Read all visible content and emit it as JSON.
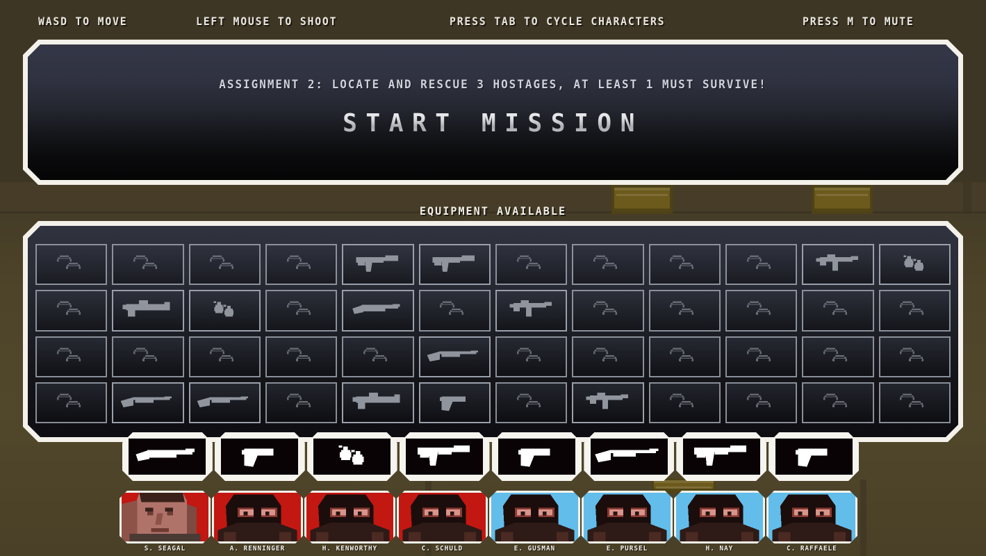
{
  "hints": [
    {
      "id": "move",
      "label": "WASD TO MOVE"
    },
    {
      "id": "shoot",
      "label": "LEFT MOUSE TO SHOOT"
    },
    {
      "id": "cycle",
      "label": "PRESS TAB TO CYCLE CHARACTERS"
    },
    {
      "id": "mute",
      "label": "PRESS M TO MUTE"
    }
  ],
  "mission": {
    "objective": "ASSIGNMENT 2:  LOCATE AND RESCUE 3 HOSTAGES,  AT LEAST 1 MUST SURVIVE!",
    "start_label": "START MISSION"
  },
  "equipment": {
    "heading": "EQUIPMENT AVAILABLE",
    "rows": 4,
    "columns": 12,
    "cells": [
      "ammo-clips",
      "ammo-clips",
      "ammo-clips",
      "ammo-clips",
      "assault-rifle",
      "assault-rifle",
      "ammo-clips",
      "ammo-clips",
      "ammo-clips",
      "ammo-clips",
      "submachine-gun",
      "grenades",
      "ammo-clips",
      "rocket-launcher",
      "grenades",
      "ammo-clips",
      "shotgun",
      "ammo-clips",
      "submachine-gun",
      "ammo-clips",
      "ammo-clips",
      "ammo-clips",
      "ammo-clips",
      "ammo-clips",
      "ammo-clips",
      "ammo-clips",
      "ammo-clips",
      "ammo-clips",
      "ammo-clips",
      "rifle",
      "ammo-clips",
      "ammo-clips",
      "ammo-clips",
      "ammo-clips",
      "ammo-clips",
      "ammo-clips",
      "ammo-clips",
      "rifle",
      "rifle",
      "ammo-clips",
      "rocket-launcher",
      "pistol",
      "ammo-clips",
      "submachine-gun",
      "ammo-clips",
      "ammo-clips",
      "ammo-clips",
      "ammo-clips"
    ]
  },
  "weapon_slots": [
    {
      "index": 1,
      "icon": "shotgun"
    },
    {
      "index": 2,
      "icon": "pistol"
    },
    {
      "index": 3,
      "icon": "grenades"
    },
    {
      "index": 4,
      "icon": "assault-rifle"
    },
    {
      "index": 5,
      "icon": "pistol"
    },
    {
      "index": 6,
      "icon": "rifle"
    },
    {
      "index": 7,
      "icon": "assault-rifle"
    },
    {
      "index": 8,
      "icon": "pistol"
    }
  ],
  "characters": [
    {
      "name": "S. SEAGAL",
      "team_color": "#c31712",
      "face": "unmasked"
    },
    {
      "name": "A. RENNINGER",
      "team_color": "#c31712",
      "face": "masked"
    },
    {
      "name": "H. KENWORTHY",
      "team_color": "#c31712",
      "face": "masked"
    },
    {
      "name": "C. SCHULD",
      "team_color": "#c31712",
      "face": "masked"
    },
    {
      "name": "E. GUSMAN",
      "team_color": "#62bdea",
      "face": "masked"
    },
    {
      "name": "E. PURSEL",
      "team_color": "#62bdea",
      "face": "masked"
    },
    {
      "name": "H. NAY",
      "team_color": "#62bdea",
      "face": "masked"
    },
    {
      "name": "C. RAFFAELE",
      "team_color": "#62bdea",
      "face": "masked"
    }
  ],
  "colors": {
    "background": "#4a4027",
    "panel_border": "#f3f1ea",
    "panel_fill": "#1a1c24",
    "hint_text": "#e9e7df",
    "equipment_icon": "#8f949d",
    "crate": "#6b5a1b"
  }
}
